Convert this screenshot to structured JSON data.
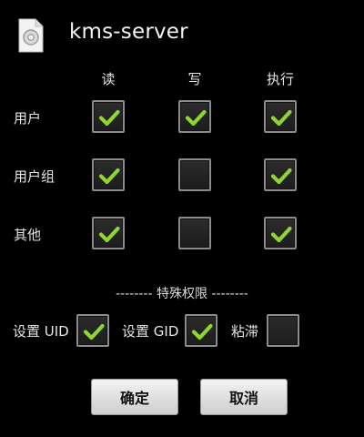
{
  "dialog": {
    "title": "kms-server",
    "icon": "file-icon"
  },
  "columns": [
    "读",
    "写",
    "执行"
  ],
  "rows": [
    {
      "label": "用户",
      "read": true,
      "write": true,
      "execute": true
    },
    {
      "label": "用户组",
      "read": true,
      "write": false,
      "execute": true
    },
    {
      "label": "其他",
      "read": true,
      "write": false,
      "execute": true
    }
  ],
  "special": {
    "title": "-------- 特殊权限 --------",
    "set_uid": {
      "label": "设置 UID",
      "checked": true
    },
    "set_gid": {
      "label": "设置 GID",
      "checked": true
    },
    "sticky": {
      "label": "粘滞",
      "checked": false
    }
  },
  "buttons": {
    "ok": "确定",
    "cancel": "取消"
  },
  "colors": {
    "background": "#000000",
    "check_mark": "#8fd630",
    "checkbox_border": "#8c8c8c"
  }
}
